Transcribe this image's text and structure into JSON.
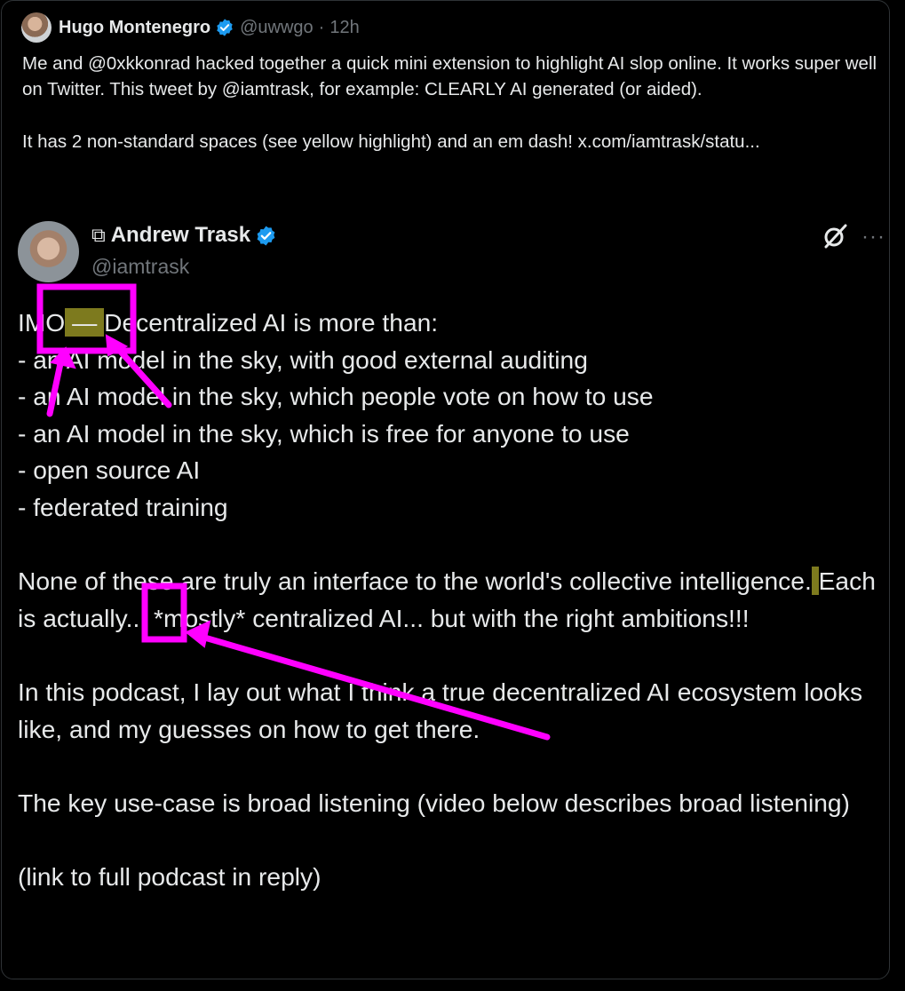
{
  "outer_tweet": {
    "author_name": "Hugo Montenegro",
    "handle": "@uwwgo",
    "separator": "·",
    "time": "12h",
    "text_line_1": "Me and @0xkkonrad hacked together a quick mini extension to highlight AI slop online. It works super well on Twitter. This tweet by @iamtrask, for example: CLEARLY AI generated (or aided).",
    "text_line_2": "It has 2 non-standard spaces (see yellow highlight) and an em dash!  x.com/iamtrask/statu..."
  },
  "quoted_tweet": {
    "author_prefix_icon": "⧉",
    "author_name": "Andrew Trask",
    "handle": "@iamtrask",
    "more_label": "···",
    "line_1_a": "IMO",
    "line_1_hl": " — ",
    "line_1_b": "Decentralized AI is more than:",
    "line_2": "- an AI model in the sky, with good external auditing",
    "line_3": "- an AI model in the sky, which people vote on how to use",
    "line_4": "- an AI model in the sky, which is free for anyone to use",
    "line_5": "- open source AI",
    "line_6": "- federated training",
    "para_2_a": "None of these are truly an interface to the world's collective intelligence.",
    "para_2_hl": " ",
    "para_2_b": "Each is actually... *mostly* centralized AI... but with the right ambitions!!!",
    "para_3": "In this podcast, I lay out what I think a true decentralized AI ecosystem looks like, and my guesses on how to get there.",
    "para_4": "The key use-case is broad listening (video below describes broad listening)",
    "para_5": "(link to full podcast in reply)"
  },
  "icons": {
    "verified": "verified-badge-icon",
    "grok": "grok-icon",
    "more": "more-icon"
  },
  "colors": {
    "verified_blue": "#1d9bf0",
    "highlight": "#7d7a1e",
    "annotation_magenta": "#ff00ff",
    "muted_text": "#71767b"
  }
}
